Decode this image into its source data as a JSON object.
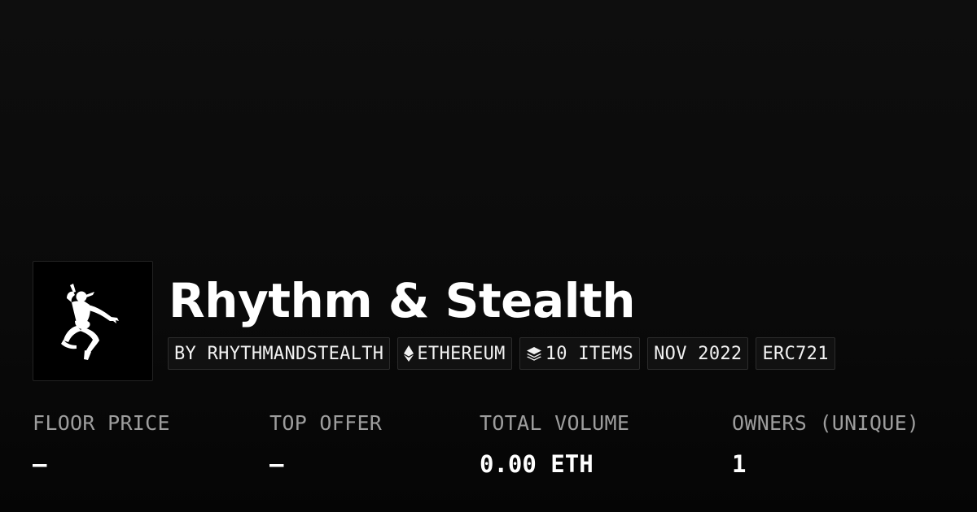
{
  "collection": {
    "name": "Rhythm & Stealth",
    "logo_icon": "dancing-ninja-silhouette-icon"
  },
  "tags": {
    "creator": "BY RHYTHMANDSTEALTH",
    "chain": "ETHEREUM",
    "chain_icon": "ethereum-icon",
    "items": "10 ITEMS",
    "items_icon": "layers-icon",
    "date": "NOV 2022",
    "standard": "ERC721"
  },
  "stats": {
    "floor_price": {
      "label": "FLOOR PRICE",
      "value": "–"
    },
    "top_offer": {
      "label": "TOP OFFER",
      "value": "–"
    },
    "total_volume": {
      "label": "TOTAL VOLUME",
      "value": "0.00 ETH"
    },
    "owners": {
      "label": "OWNERS (UNIQUE)",
      "value": "1"
    }
  },
  "colors": {
    "background": "#0b0b0b",
    "text": "#ffffff",
    "label": "#9d9d9d",
    "tag_border": "#2c2c2c"
  }
}
